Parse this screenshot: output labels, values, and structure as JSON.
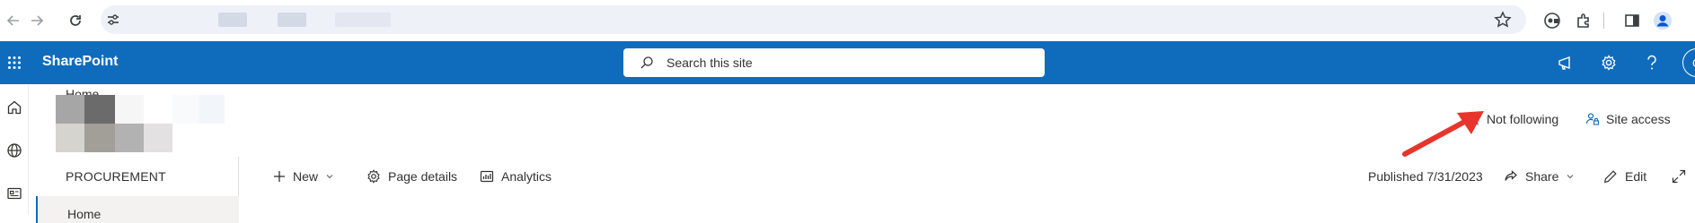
{
  "browser": {
    "icons": [
      "back-arrow-icon",
      "forward-arrow-icon",
      "reload-icon",
      "site-info-icon",
      "bookmark-star-icon",
      "password-key-icon",
      "extensions-icon",
      "side-panel-icon",
      "profile-icon"
    ]
  },
  "suite_bar": {
    "app_name": "SharePoint",
    "search_placeholder": "Search this site",
    "accent_color": "#0f6cbd"
  },
  "site_header": {
    "breadcrumb": "Home",
    "follow_label": "Not following",
    "site_access_label": "Site access"
  },
  "left_nav": {
    "title": "PROCUREMENT",
    "items": [
      {
        "label": "Home",
        "selected": true
      }
    ]
  },
  "command_bar": {
    "new_label": "New",
    "page_details_label": "Page details",
    "analytics_label": "Analytics",
    "published_text": "Published 7/31/2023",
    "share_label": "Share",
    "edit_label": "Edit"
  },
  "user": {
    "initial": "G"
  },
  "annotation": {
    "color": "#e8352c"
  }
}
